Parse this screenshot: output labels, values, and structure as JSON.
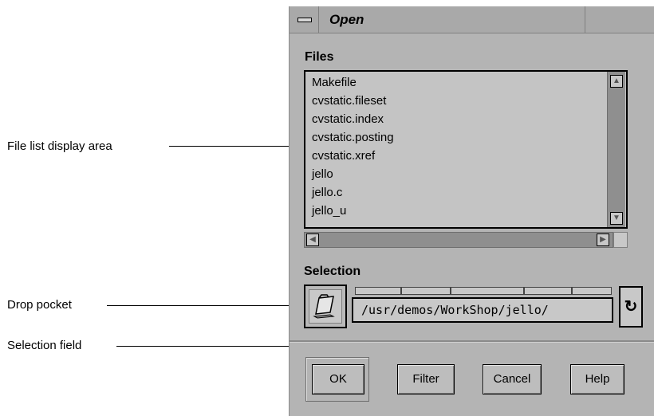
{
  "callouts": {
    "file_list": "File list display area",
    "drop_pocket": "Drop pocket",
    "selection_field": "Selection field"
  },
  "dialog": {
    "title": "Open",
    "files_label": "Files",
    "files": [
      "Makefile",
      "cvstatic.fileset",
      "cvstatic.index",
      "cvstatic.posting",
      "cvstatic.xref",
      "jello",
      "jello.c",
      "jello_u"
    ],
    "selection_label": "Selection",
    "selection_value": "/usr/demos/WorkShop/jello/",
    "buttons": {
      "ok": "OK",
      "filter": "Filter",
      "cancel": "Cancel",
      "help": "Help"
    }
  },
  "icons": {
    "window_menu": "window-menu-icon",
    "drop_pocket": "folder-icon",
    "recycle": "recycle-icon",
    "scroll_up": "arrow-up-icon",
    "scroll_down": "arrow-down-icon",
    "scroll_left": "arrow-left-icon",
    "scroll_right": "arrow-right-icon"
  }
}
